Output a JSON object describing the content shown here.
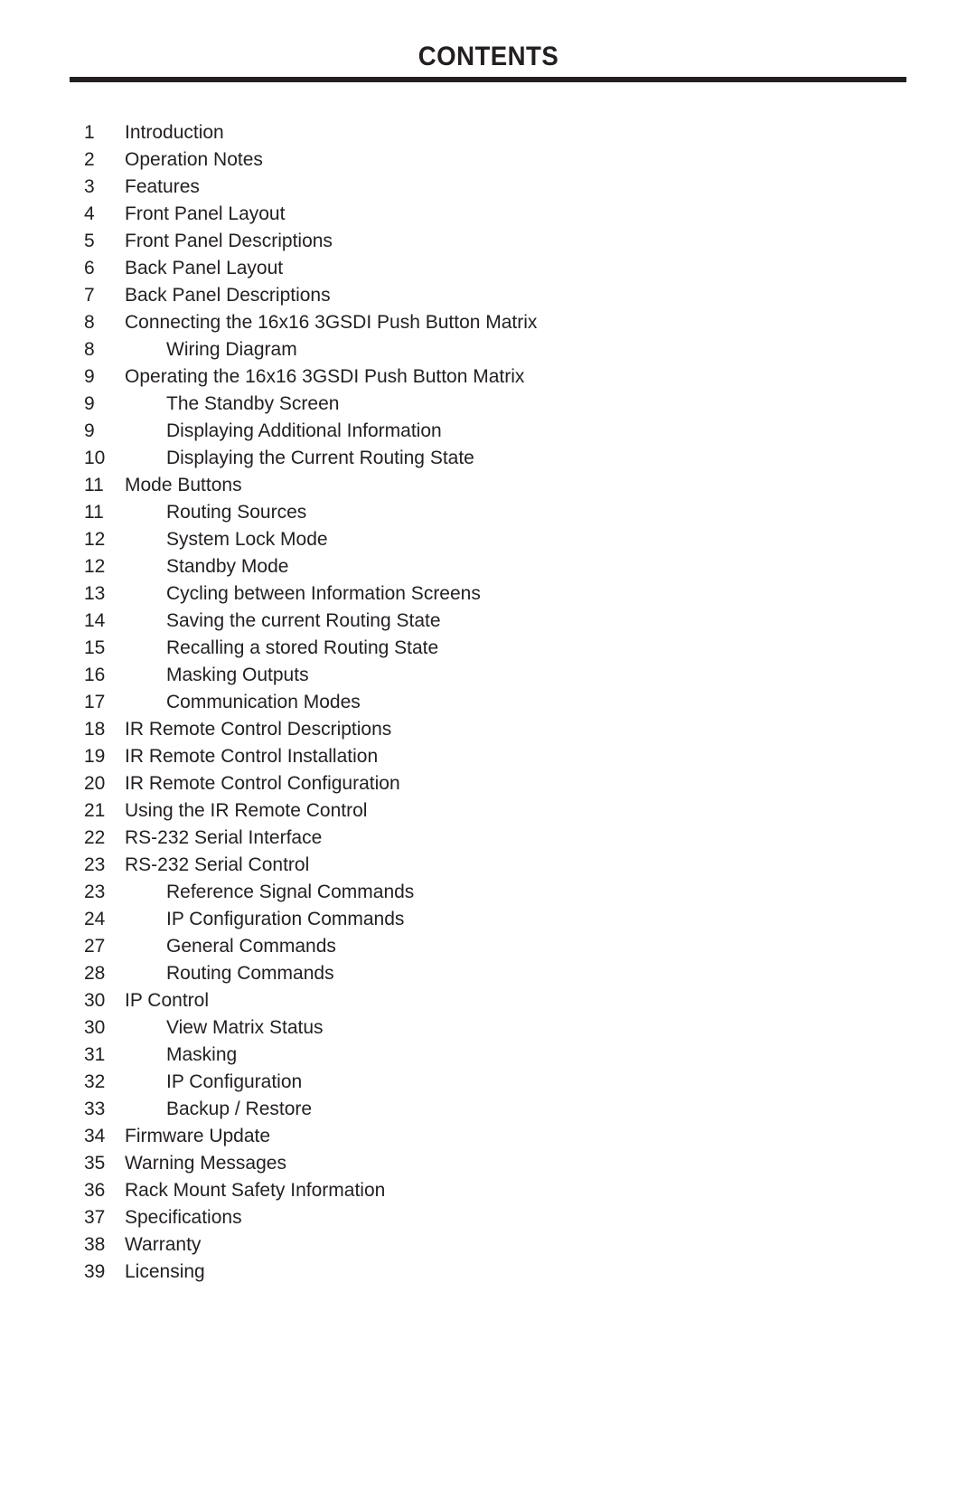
{
  "header": {
    "title": "CONTENTS"
  },
  "contents": {
    "entries": [
      {
        "page": "1",
        "label": "Introduction",
        "level": 1
      },
      {
        "page": "2",
        "label": "Operation Notes",
        "level": 1
      },
      {
        "page": "3",
        "label": "Features",
        "level": 1
      },
      {
        "page": "4",
        "label": "Front Panel Layout",
        "level": 1
      },
      {
        "page": "5",
        "label": "Front Panel Descriptions",
        "level": 1
      },
      {
        "page": "6",
        "label": "Back Panel Layout",
        "level": 1
      },
      {
        "page": "7",
        "label": "Back Panel Descriptions",
        "level": 1
      },
      {
        "page": "8",
        "label": "Connecting the 16x16 3GSDI Push Button Matrix",
        "level": 1
      },
      {
        "page": "8",
        "label": "Wiring Diagram",
        "level": 2
      },
      {
        "page": "9",
        "label": "Operating the 16x16 3GSDI Push Button Matrix",
        "level": 1
      },
      {
        "page": "9",
        "label": "The Standby Screen",
        "level": 2
      },
      {
        "page": "9",
        "label": "Displaying Additional Information",
        "level": 2
      },
      {
        "page": "10",
        "label": "Displaying the Current Routing State",
        "level": 2
      },
      {
        "page": "11",
        "label": "Mode Buttons",
        "level": 1
      },
      {
        "page": "11",
        "label": "Routing Sources",
        "level": 2
      },
      {
        "page": "12",
        "label": "System Lock Mode",
        "level": 2
      },
      {
        "page": "12",
        "label": "Standby Mode",
        "level": 2
      },
      {
        "page": "13",
        "label": "Cycling between Information Screens",
        "level": 2
      },
      {
        "page": "14",
        "label": "Saving the current Routing State",
        "level": 2
      },
      {
        "page": "15",
        "label": "Recalling a stored Routing State",
        "level": 2
      },
      {
        "page": "16",
        "label": "Masking Outputs",
        "level": 2
      },
      {
        "page": "17",
        "label": "Communication Modes",
        "level": 2
      },
      {
        "page": "18",
        "label": "IR Remote Control Descriptions",
        "level": 1
      },
      {
        "page": "19",
        "label": "IR Remote Control Installation",
        "level": 1
      },
      {
        "page": "20",
        "label": "IR Remote Control Configuration",
        "level": 1
      },
      {
        "page": "21",
        "label": "Using the IR Remote Control",
        "level": 1
      },
      {
        "page": "22",
        "label": "RS-232 Serial Interface",
        "level": 1
      },
      {
        "page": "23",
        "label": "RS-232 Serial Control",
        "level": 1
      },
      {
        "page": "23",
        "label": "Reference Signal Commands",
        "level": 2
      },
      {
        "page": "24",
        "label": "IP Configuration Commands",
        "level": 2
      },
      {
        "page": "27",
        "label": "General Commands",
        "level": 2
      },
      {
        "page": "28",
        "label": "Routing Commands",
        "level": 2
      },
      {
        "page": "30",
        "label": "IP Control",
        "level": 1
      },
      {
        "page": "30",
        "label": "View Matrix Status",
        "level": 2
      },
      {
        "page": "31",
        "label": "Masking",
        "level": 2
      },
      {
        "page": "32",
        "label": "IP Configuration",
        "level": 2
      },
      {
        "page": "33",
        "label": "Backup / Restore",
        "level": 2
      },
      {
        "page": "34",
        "label": "Firmware Update",
        "level": 1
      },
      {
        "page": "35",
        "label": "Warning Messages",
        "level": 1
      },
      {
        "page": "36",
        "label": "Rack Mount Safety Information",
        "level": 1
      },
      {
        "page": "37",
        "label": "Specifications",
        "level": 1
      },
      {
        "page": "38",
        "label": "Warranty",
        "level": 1
      },
      {
        "page": "39",
        "label": "Licensing",
        "level": 1
      }
    ]
  }
}
